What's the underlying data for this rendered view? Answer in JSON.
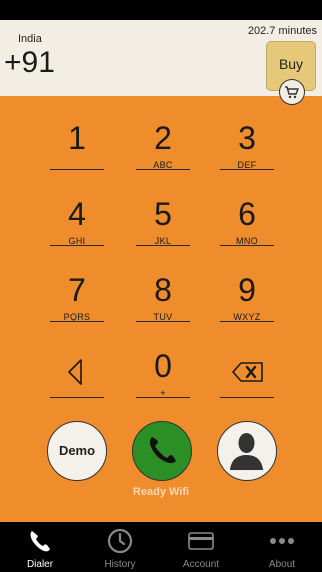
{
  "header": {
    "country": "India",
    "code": "+91",
    "minutes": "202.7 minutes",
    "buy_label": "Buy"
  },
  "keypad": {
    "keys": [
      {
        "number": "1",
        "letters": ""
      },
      {
        "number": "2",
        "letters": "ABC"
      },
      {
        "number": "3",
        "letters": "DEF"
      },
      {
        "number": "4",
        "letters": "GHI"
      },
      {
        "number": "5",
        "letters": "JKL"
      },
      {
        "number": "6",
        "letters": "MNO"
      },
      {
        "number": "7",
        "letters": "PQRS"
      },
      {
        "number": "8",
        "letters": "TUV"
      },
      {
        "number": "9",
        "letters": "WXYZ"
      },
      {
        "number": "0",
        "letters": "+"
      }
    ]
  },
  "actions": {
    "demo_label": "Demo",
    "status": "Ready Wifi"
  },
  "tabs": [
    {
      "label": "Dialer",
      "icon": "phone-icon",
      "active": true
    },
    {
      "label": "History",
      "icon": "clock-icon",
      "active": false
    },
    {
      "label": "Account",
      "icon": "credit-card-icon",
      "active": false
    },
    {
      "label": "About",
      "icon": "more-icon",
      "active": false
    }
  ],
  "colors": {
    "background": "#ef8c2c",
    "header": "#f2eee3",
    "buy": "#e5c878",
    "call": "#2b8f25"
  }
}
